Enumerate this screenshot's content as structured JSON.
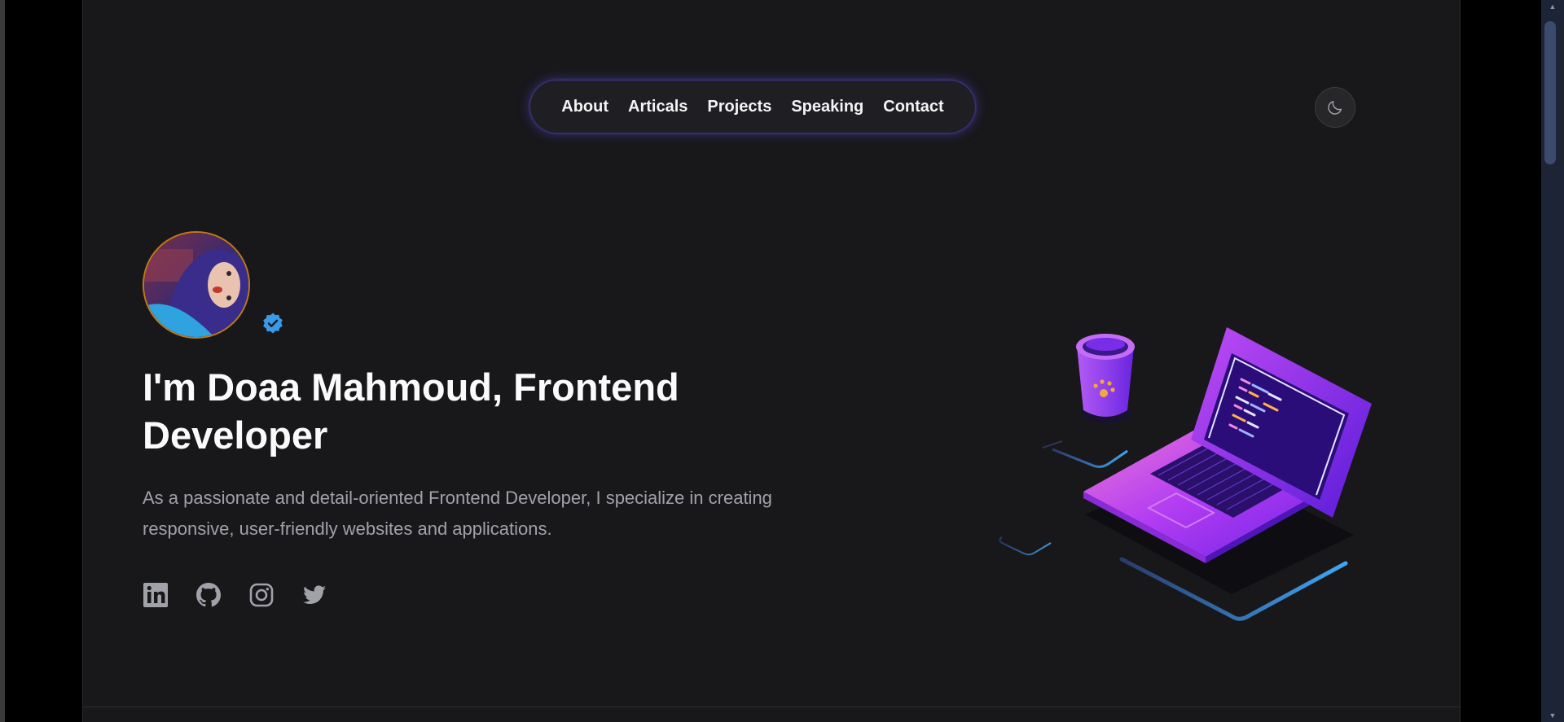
{
  "nav": {
    "items": [
      {
        "label": "About"
      },
      {
        "label": "Articals"
      },
      {
        "label": "Projects"
      },
      {
        "label": "Speaking"
      },
      {
        "label": "Contact"
      }
    ]
  },
  "theme_toggle": {
    "icon": "moon-icon"
  },
  "hero": {
    "avatar": {
      "icon": "profile-photo",
      "verified_icon": "verified-badge-icon"
    },
    "headline": "I'm Doaa Mahmoud, Frontend Developer",
    "intro": "As a passionate and detail-oriented Frontend Developer, I specialize in creating responsive, user-friendly websites and applications.",
    "socials": [
      {
        "icon": "linkedin-icon"
      },
      {
        "icon": "github-icon"
      },
      {
        "icon": "instagram-icon"
      },
      {
        "icon": "twitter-icon"
      }
    ]
  },
  "illustration": {
    "icon": "laptop-coffee-illustration"
  },
  "colors": {
    "background": "#18181b",
    "nav_glow": "#6350ff",
    "accent_purple": "#8b2cf5",
    "verified_blue": "#3b9ae8"
  }
}
